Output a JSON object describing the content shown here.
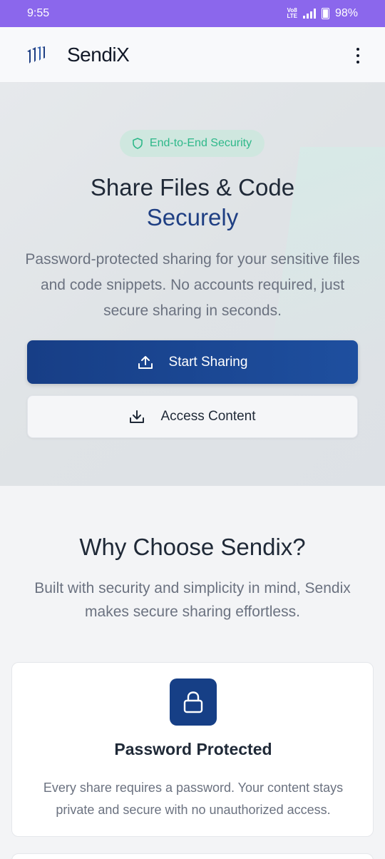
{
  "status": {
    "time": "9:55",
    "battery": "98%",
    "volte_top": "Vo8",
    "volte_bottom": "LTE"
  },
  "header": {
    "brand": "SendiX",
    "logo_icon": "sendix-logo-icon",
    "menu_icon": "more-vert-icon"
  },
  "hero": {
    "badge": "End-to-End Security",
    "badge_icon": "shield-icon",
    "title_line1": "Share Files & Code",
    "title_line2": "Securely",
    "description": "Password-protected sharing for your sensitive files and code snippets. No accounts required, just secure sharing in seconds.",
    "primary_button": "Start Sharing",
    "primary_icon": "upload-icon",
    "secondary_button": "Access Content",
    "secondary_icon": "download-icon"
  },
  "why": {
    "title": "Why Choose Sendix?",
    "description": "Built with security and simplicity in mind, Sendix makes secure sharing effortless."
  },
  "features": [
    {
      "icon": "lock-icon",
      "title": "Password Protected",
      "description": "Every share requires a password. Your content stays private and secure with no unauthorized access."
    }
  ],
  "colors": {
    "status_bar": "#8b67ec",
    "primary": "#173e86",
    "accent_green": "#2eb88a"
  }
}
